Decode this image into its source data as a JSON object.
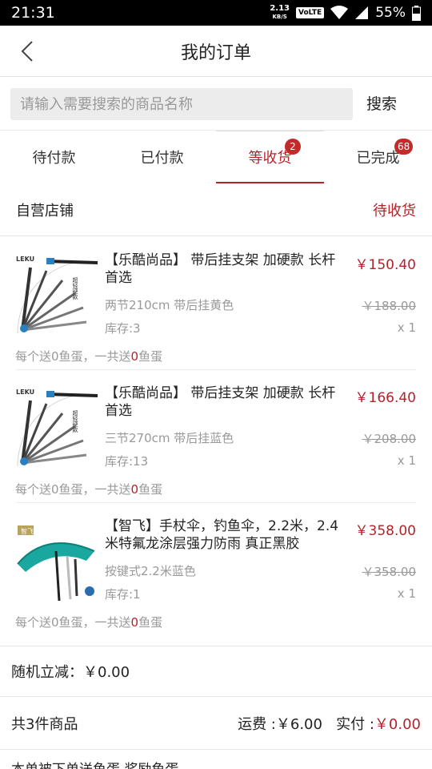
{
  "status_bar": {
    "time": "21:31",
    "speed_value": "2.13",
    "speed_unit": "KB/S",
    "network": "VoLTE",
    "battery": "55%"
  },
  "header": {
    "title": "我的订单"
  },
  "search": {
    "placeholder": "请输入需要搜索的商品名称",
    "value": "",
    "button_label": "搜索"
  },
  "tabs": [
    {
      "label": "待付款",
      "badge": ""
    },
    {
      "label": "已付款",
      "badge": ""
    },
    {
      "label": "等收货",
      "badge": "2"
    },
    {
      "label": "已完成",
      "badge": "68"
    }
  ],
  "active_tab": 2,
  "order": {
    "store_name": "自营店铺",
    "store_status": "待收货",
    "items": [
      {
        "title": "【乐酷尚品】 带后挂支架 加硬款 长杆首选",
        "price": "￥150.40",
        "variant": "两节210cm 带后挂黄色",
        "old_price": "￥188.00",
        "stock": "库存:3",
        "qty": "x 1",
        "eggs_a": "每个送0鱼蛋，一共送",
        "eggs_num": "0",
        "eggs_b": "鱼蛋",
        "thumb_brand": "LEKU",
        "thumb_text": "超轻硬款"
      },
      {
        "title": "【乐酷尚品】 带后挂支架 加硬款 长杆首选",
        "price": "￥166.40",
        "variant": "三节270cm 带后挂蓝色",
        "old_price": "￥208.00",
        "stock": "库存:13",
        "qty": "x 1",
        "eggs_a": "每个送0鱼蛋，一共送",
        "eggs_num": "0",
        "eggs_b": "鱼蛋",
        "thumb_brand": "LEKU",
        "thumb_text": "超轻硬款"
      },
      {
        "title": "【智飞】手杖伞，钓鱼伞，2.2米，2.4米特氟龙涂层强力防雨 真正黑胶",
        "price": "￥358.00",
        "variant": "按键式2.2米蓝色",
        "old_price": "￥358.00",
        "stock": "库存:1",
        "qty": "x 1",
        "eggs_a": "每个送0鱼蛋，一共送",
        "eggs_num": "0",
        "eggs_b": "鱼蛋",
        "thumb_brand": "智飞",
        "thumb_text": ""
      }
    ]
  },
  "random_reduce": {
    "label": "随机立减：",
    "value": "￥0.00"
  },
  "summary": {
    "count": "共3件商品",
    "shipping_label": "运费 :",
    "shipping": "￥6.00",
    "paid_label": "实付 :",
    "paid": "￥0.00"
  },
  "partial_text": "本单被下单送鱼蛋 奖励鱼蛋"
}
